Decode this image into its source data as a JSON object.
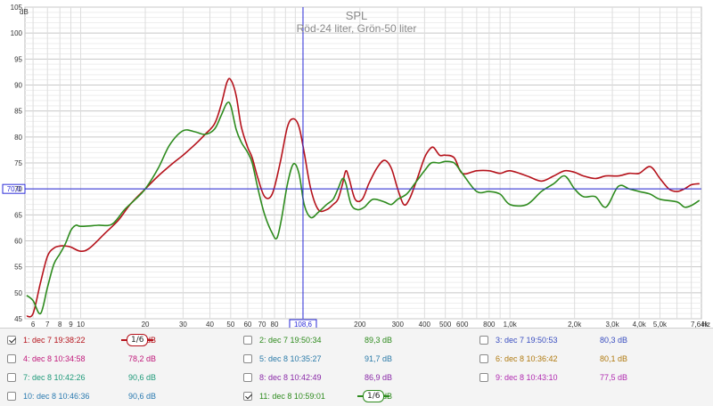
{
  "chart_data": {
    "type": "line",
    "title": "SPL",
    "subtitle": "Röd-24 liter, Grön-50 liter",
    "ylabel": "dB",
    "xunit": "Hz",
    "xscale": "log",
    "xlim": [
      5.5,
      7800
    ],
    "ylim": [
      45,
      105
    ],
    "grid": true,
    "y_ticks": [
      "45",
      "50",
      "55",
      "60",
      "65",
      "70",
      "75",
      "80",
      "85",
      "90",
      "95",
      "100",
      "105"
    ],
    "x_ticks": [
      {
        "v": 6,
        "label": "6"
      },
      {
        "v": 7,
        "label": "7"
      },
      {
        "v": 8,
        "label": "8"
      },
      {
        "v": 9,
        "label": "9"
      },
      {
        "v": 10,
        "label": "10"
      },
      {
        "v": 20,
        "label": "20"
      },
      {
        "v": 30,
        "label": "30"
      },
      {
        "v": 40,
        "label": "40"
      },
      {
        "v": 50,
        "label": "50"
      },
      {
        "v": 60,
        "label": "60"
      },
      {
        "v": 70,
        "label": "70"
      },
      {
        "v": 80,
        "label": "80"
      },
      {
        "v": 200,
        "label": "200"
      },
      {
        "v": 300,
        "label": "300"
      },
      {
        "v": 400,
        "label": "400"
      },
      {
        "v": 500,
        "label": "500"
      },
      {
        "v": 600,
        "label": "600"
      },
      {
        "v": 800,
        "label": "800"
      },
      {
        "v": 1000,
        "label": "1,0k"
      },
      {
        "v": 2000,
        "label": "2,0k"
      },
      {
        "v": 3000,
        "label": "3,0k"
      },
      {
        "v": 4000,
        "label": "4,0k"
      },
      {
        "v": 5000,
        "label": "5,0k"
      },
      {
        "v": 7640,
        "label": "7,64k"
      }
    ],
    "cursor": {
      "x": 108.6,
      "x_label": "108,6",
      "y": 70.0,
      "y_label": "70,0"
    },
    "series": [
      {
        "color": "#b5121b",
        "points": [
          [
            5.6,
            45.5
          ],
          [
            6,
            46
          ],
          [
            6.5,
            52
          ],
          [
            7,
            57
          ],
          [
            7.5,
            58.6
          ],
          [
            8,
            59
          ],
          [
            8.5,
            59
          ],
          [
            9,
            58.8
          ],
          [
            10,
            58
          ],
          [
            11,
            58.6
          ],
          [
            13,
            61.5
          ],
          [
            15,
            64
          ],
          [
            17,
            67
          ],
          [
            20,
            70
          ],
          [
            23,
            72.5
          ],
          [
            27,
            75
          ],
          [
            30,
            76.5
          ],
          [
            34,
            78.5
          ],
          [
            38,
            80.5
          ],
          [
            42,
            82.5
          ],
          [
            45,
            86
          ],
          [
            48,
            90.5
          ],
          [
            50,
            91
          ],
          [
            53,
            88
          ],
          [
            56,
            82
          ],
          [
            60,
            78
          ],
          [
            63,
            76
          ],
          [
            67,
            72
          ],
          [
            72,
            68.5
          ],
          [
            78,
            69
          ],
          [
            85,
            75
          ],
          [
            92,
            82
          ],
          [
            98,
            83.5
          ],
          [
            104,
            82
          ],
          [
            110,
            77
          ],
          [
            118,
            70
          ],
          [
            128,
            66
          ],
          [
            140,
            66
          ],
          [
            150,
            67
          ],
          [
            158,
            68
          ],
          [
            166,
            71
          ],
          [
            172,
            73.5
          ],
          [
            178,
            72
          ],
          [
            190,
            68
          ],
          [
            205,
            68
          ],
          [
            220,
            71
          ],
          [
            240,
            74
          ],
          [
            260,
            75.5
          ],
          [
            280,
            74
          ],
          [
            300,
            70
          ],
          [
            320,
            67
          ],
          [
            340,
            68
          ],
          [
            370,
            72
          ],
          [
            400,
            76
          ],
          [
            420,
            77.5
          ],
          [
            440,
            78
          ],
          [
            470,
            76.5
          ],
          [
            500,
            76.5
          ],
          [
            550,
            76
          ],
          [
            600,
            73
          ],
          [
            700,
            73.5
          ],
          [
            800,
            73.5
          ],
          [
            900,
            73
          ],
          [
            1000,
            73.5
          ],
          [
            1200,
            72.5
          ],
          [
            1400,
            71.5
          ],
          [
            1600,
            72.5
          ],
          [
            1800,
            73.5
          ],
          [
            2000,
            73.2
          ],
          [
            2200,
            72.5
          ],
          [
            2500,
            72
          ],
          [
            2800,
            72.5
          ],
          [
            3200,
            72.5
          ],
          [
            3600,
            73
          ],
          [
            4000,
            73
          ],
          [
            4500,
            74.3
          ],
          [
            5000,
            72
          ],
          [
            5500,
            70
          ],
          [
            6000,
            69.5
          ],
          [
            6500,
            70
          ],
          [
            7000,
            70.8
          ],
          [
            7640,
            71
          ]
        ]
      },
      {
        "color": "#2e8b1e",
        "points": [
          [
            5.6,
            49.5
          ],
          [
            6,
            48.5
          ],
          [
            6.5,
            46
          ],
          [
            7,
            51
          ],
          [
            7.5,
            55.5
          ],
          [
            8,
            57.5
          ],
          [
            8.5,
            59.5
          ],
          [
            9,
            62
          ],
          [
            9.5,
            63
          ],
          [
            10,
            62.8
          ],
          [
            12,
            63
          ],
          [
            14,
            63.2
          ],
          [
            16,
            66
          ],
          [
            18,
            68
          ],
          [
            20,
            70
          ],
          [
            23,
            74
          ],
          [
            26,
            78.5
          ],
          [
            30,
            81.2
          ],
          [
            34,
            81
          ],
          [
            38,
            80.5
          ],
          [
            42,
            81.5
          ],
          [
            45,
            84
          ],
          [
            48,
            86.5
          ],
          [
            50,
            86
          ],
          [
            53,
            81.5
          ],
          [
            56,
            79
          ],
          [
            60,
            77
          ],
          [
            63,
            75
          ],
          [
            67,
            70
          ],
          [
            72,
            65
          ],
          [
            78,
            61.5
          ],
          [
            82,
            60.5
          ],
          [
            86,
            64
          ],
          [
            92,
            71
          ],
          [
            98,
            74.8
          ],
          [
            104,
            73
          ],
          [
            110,
            67
          ],
          [
            118,
            64.5
          ],
          [
            128,
            65.5
          ],
          [
            140,
            67
          ],
          [
            150,
            68
          ],
          [
            158,
            70
          ],
          [
            166,
            72
          ],
          [
            172,
            71
          ],
          [
            182,
            67
          ],
          [
            195,
            66
          ],
          [
            210,
            66.5
          ],
          [
            230,
            68
          ],
          [
            260,
            67.5
          ],
          [
            280,
            67
          ],
          [
            300,
            68
          ],
          [
            330,
            69
          ],
          [
            360,
            71
          ],
          [
            400,
            73.5
          ],
          [
            430,
            75
          ],
          [
            470,
            75
          ],
          [
            500,
            75.3
          ],
          [
            550,
            75
          ],
          [
            600,
            73
          ],
          [
            700,
            69.5
          ],
          [
            800,
            69.5
          ],
          [
            900,
            69
          ],
          [
            1000,
            67
          ],
          [
            1200,
            67
          ],
          [
            1400,
            69.5
          ],
          [
            1600,
            71
          ],
          [
            1800,
            72.5
          ],
          [
            2000,
            70
          ],
          [
            2200,
            68.5
          ],
          [
            2500,
            68.5
          ],
          [
            2800,
            66.5
          ],
          [
            3200,
            70.5
          ],
          [
            3600,
            70
          ],
          [
            4000,
            69.5
          ],
          [
            4500,
            69
          ],
          [
            5000,
            68
          ],
          [
            6000,
            67.5
          ],
          [
            6500,
            66.5
          ],
          [
            7000,
            66.8
          ],
          [
            7640,
            67.8
          ]
        ]
      }
    ]
  },
  "legend": {
    "items": [
      {
        "label": "1: dec 7 19:38:22",
        "value": "83,5 dB",
        "color": "#b5121b",
        "checked": true,
        "smoothing": "1/6"
      },
      {
        "label": "2: dec 7 19:50:34",
        "value": "89,3 dB",
        "color": "#2e8b1e",
        "checked": false
      },
      {
        "label": "3: dec 7 19:50:53",
        "value": "80,3 dB",
        "color": "#3a4ec0",
        "checked": false
      },
      {
        "label": "4: dec 8 10:34:58",
        "value": "78,2 dB",
        "color": "#c0187a",
        "checked": false
      },
      {
        "label": "5: dec 8 10:35:27",
        "value": "91,7 dB",
        "color": "#2a7aa8",
        "checked": false
      },
      {
        "label": "6: dec 8 10:36:42",
        "value": "80,1 dB",
        "color": "#b07a10",
        "checked": false
      },
      {
        "label": "7: dec 8 10:42:26",
        "value": "90,6 dB",
        "color": "#1f9a7a",
        "checked": false
      },
      {
        "label": "8: dec 8 10:42:49",
        "value": "86,9 dB",
        "color": "#8a2aa8",
        "checked": false
      },
      {
        "label": "9: dec 8 10:43:10",
        "value": "77,5 dB",
        "color": "#b02ab0",
        "checked": false
      },
      {
        "label": "10: dec 8 10:46:36",
        "value": "90,6 dB",
        "color": "#2a7ab0",
        "checked": false
      },
      {
        "label": "11: dec 8 10:59:01",
        "value": "74,8 dB",
        "color": "#2e8b1e",
        "checked": true,
        "smoothing": "1/6"
      }
    ]
  }
}
